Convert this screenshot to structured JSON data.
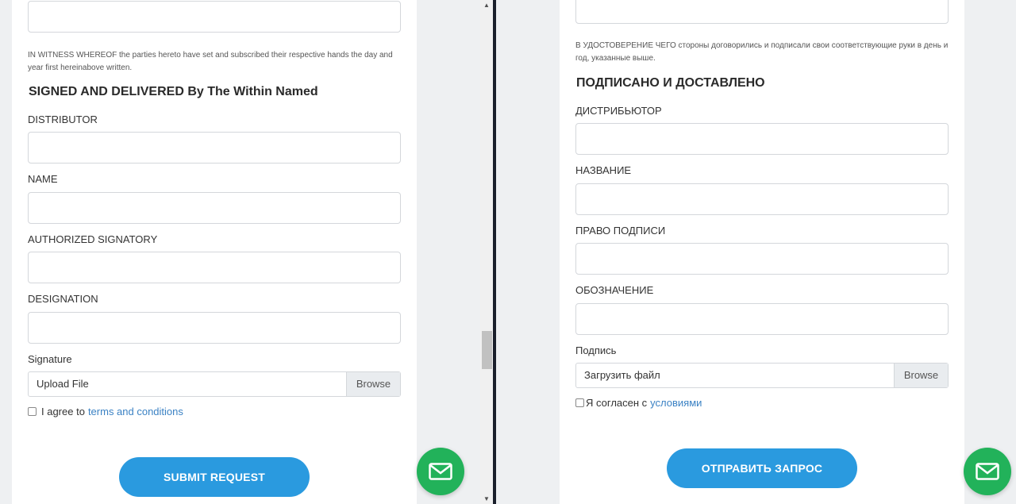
{
  "left": {
    "witness_text": "IN WITNESS WHEREOF the parties hereto have set and subscribed their respective hands the day and year first hereinabove written.",
    "heading": "SIGNED AND DELIVERED By The Within Named",
    "fields": {
      "distributor": "DISTRIBUTOR",
      "name": "NAME",
      "signatory": "AUTHORIZED SIGNATORY",
      "designation": "DESIGNATION",
      "signature": "Signature"
    },
    "upload_placeholder": "Upload File",
    "browse_label": "Browse",
    "agree_prefix": "I agree to",
    "agree_link": "terms and conditions",
    "submit_label": "SUBMIT REQUEST"
  },
  "right": {
    "witness_text": "В УДОСТОВЕРЕНИЕ ЧЕГО стороны договорились и подписали свои соответствующие руки в день и год, указанные выше.",
    "heading": "ПОДПИСАНО И ДОСТАВЛЕНО",
    "fields": {
      "distributor": "ДИСТРИБЬЮТОР",
      "name": "НАЗВАНИЕ",
      "signatory": "ПРАВО ПОДПИСИ",
      "designation": "ОБОЗНАЧЕНИЕ",
      "signature": "Подпись"
    },
    "upload_placeholder": "Загрузить файл",
    "browse_label": "Browse",
    "agree_prefix": "Я согласен с",
    "agree_link": "условиями",
    "submit_label": "ОТПРАВИТЬ ЗАПРОС"
  },
  "icons": {
    "fab": "mail-icon",
    "scroll_up": "scroll-up-arrow-icon",
    "scroll_down": "scroll-down-arrow-icon"
  },
  "colors": {
    "accent": "#2a9adf",
    "link": "#3b82c4",
    "fab": "#22b25a"
  }
}
